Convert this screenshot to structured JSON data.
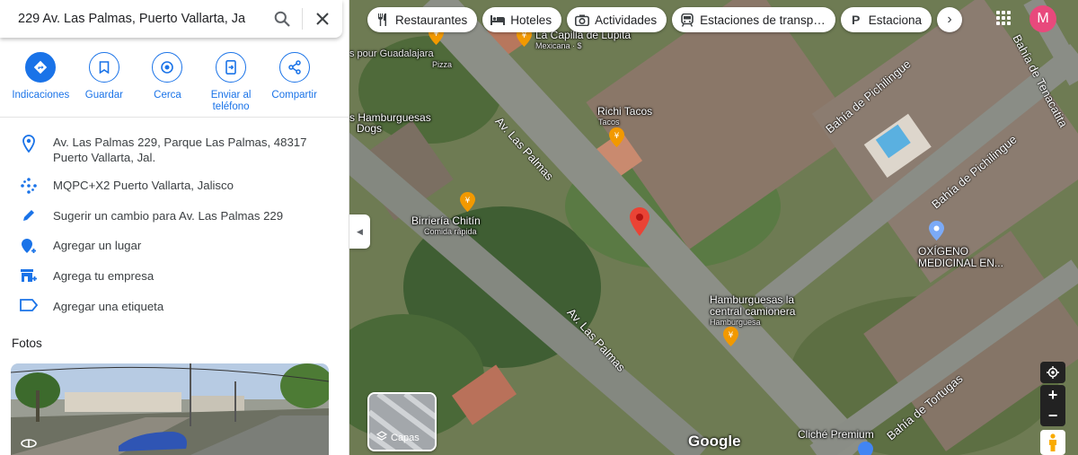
{
  "search": {
    "query": "229 Av. Las Palmas, Puerto Vallarta, Ja"
  },
  "actions": [
    {
      "label": "Indicaciones"
    },
    {
      "label": "Guardar"
    },
    {
      "label": "Cerca"
    },
    {
      "label": "Enviar al teléfono"
    },
    {
      "label": "Compartir"
    }
  ],
  "info": {
    "address_line1": "Av. Las Palmas 229, Parque Las Palmas, 48317",
    "address_line2": "Puerto Vallarta, Jal.",
    "plus_code": "MQPC+X2 Puerto Vallarta, Jalisco",
    "suggest_edit": "Sugerir un cambio para Av. Las Palmas 229",
    "add_place": "Agregar un lugar",
    "add_business": "Agrega tu empresa",
    "add_label": "Agregar una etiqueta"
  },
  "photos": {
    "title": "Fotos"
  },
  "chips": [
    {
      "label": "Restaurantes",
      "icon": "fork-knife-icon"
    },
    {
      "label": "Hoteles",
      "icon": "bed-icon"
    },
    {
      "label": "Actividades",
      "icon": "camera-icon"
    },
    {
      "label": "Estaciones de transp…",
      "icon": "train-icon"
    },
    {
      "label": "Estaciona",
      "icon": "parking-icon"
    }
  ],
  "account": {
    "initial": "M",
    "color": "#e8497c"
  },
  "map": {
    "places": {
      "capilla_title": "La Capilla de Lupita",
      "capilla_sub": "Mexicana · $",
      "guadalajara_title": "s pour Guadalajara",
      "guadalajara_sub": "Pizza",
      "richi_title": "Richi Tacos",
      "richi_sub": "Tacos",
      "hamb_dogs_title1": "s Hamburguesas",
      "hamb_dogs_title2": "Dogs",
      "birrieria_title": "Birriería Chitín",
      "birrieria_sub": "Comida rápida",
      "hamb_central_title1": "Hamburguesas la",
      "hamb_central_title2": "central camionera",
      "hamb_central_sub": "Hamburguesa",
      "oxigeno_title1": "OXÍGENO",
      "oxigeno_title2": "MEDICINAL EN...",
      "cliche_title": "Cliché Premium"
    },
    "streets": {
      "palmas_top": "Av. Las Palmas",
      "palmas_bottom": "Av. Las Palmas",
      "pichilingue_1": "Bahía de Pichilingue",
      "pichilingue_2": "Bahía de Pichilingue",
      "tenacatita": "Bahía de Tenacatita",
      "tortugas": "Bahía de Tortugas"
    },
    "layers_label": "Capas",
    "brand": "Google",
    "pin_color": "#ea4335",
    "poi_color": "#f29900"
  }
}
